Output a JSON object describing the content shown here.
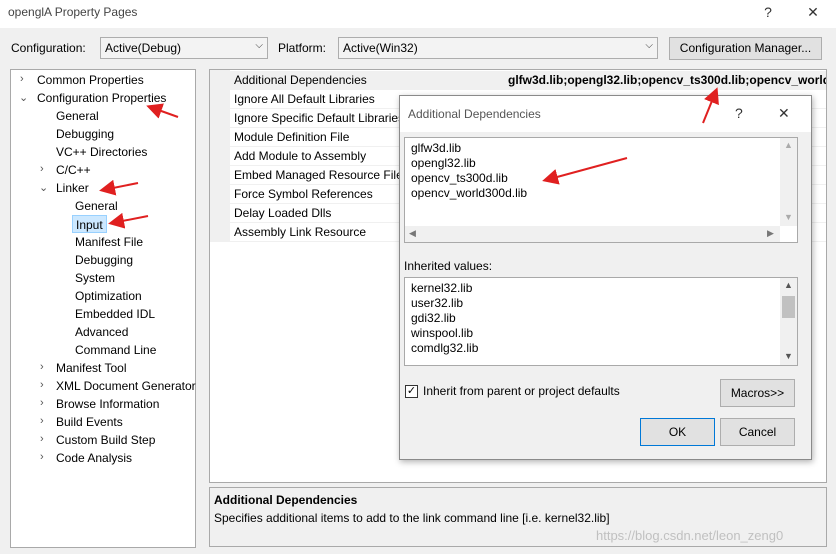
{
  "window": {
    "title": "openglA Property Pages",
    "help_btn": "?",
    "close_btn": "✕"
  },
  "config_row": {
    "configuration_label": "Configuration:",
    "configuration_value": "Active(Debug)",
    "platform_label": "Platform:",
    "platform_value": "Active(Win32)",
    "manager_button": "Configuration Manager..."
  },
  "tree": {
    "common_properties": "Common Properties",
    "configuration_properties": "Configuration Properties",
    "general": "General",
    "debugging": "Debugging",
    "vc_directories": "VC++ Directories",
    "c_cpp": "C/C++",
    "linker": "Linker",
    "linker_general": "General",
    "linker_input": "Input",
    "linker_manifest_file": "Manifest File",
    "linker_debugging": "Debugging",
    "linker_system": "System",
    "linker_optimization": "Optimization",
    "linker_embedded_idl": "Embedded IDL",
    "linker_advanced": "Advanced",
    "linker_command_line": "Command Line",
    "manifest_tool": "Manifest Tool",
    "xml_document_generator": "XML Document Generator",
    "browse_information": "Browse Information",
    "build_events": "Build Events",
    "custom_build_step": "Custom Build Step",
    "code_analysis": "Code Analysis"
  },
  "properties": [
    {
      "name": "Additional Dependencies",
      "value": "glfw3d.lib;opengl32.lib;opencv_ts300d.lib;opencv_world300d.lib"
    },
    {
      "name": "Ignore All Default Libraries"
    },
    {
      "name": "Ignore Specific Default Libraries"
    },
    {
      "name": "Module Definition File"
    },
    {
      "name": "Add Module to Assembly"
    },
    {
      "name": "Embed Managed Resource File"
    },
    {
      "name": "Force Symbol References"
    },
    {
      "name": "Delay Loaded Dlls"
    },
    {
      "name": "Assembly Link Resource"
    }
  ],
  "description": {
    "title": "Additional Dependencies",
    "text": "Specifies additional items to add to the link command line [i.e. kernel32.lib]"
  },
  "watermark": "https://blog.csdn.net/leon_zeng0",
  "dialog": {
    "title": "Additional Dependencies",
    "help_btn": "?",
    "close_btn": "✕",
    "entries": [
      "glfw3d.lib",
      "opengl32.lib",
      "opencv_ts300d.lib",
      "opencv_world300d.lib"
    ],
    "inherited_label": "Inherited values:",
    "inherited": [
      "kernel32.lib",
      "user32.lib",
      "gdi32.lib",
      "winspool.lib",
      "comdlg32.lib"
    ],
    "inherit_checkbox_label": "Inherit from parent or project defaults",
    "inherit_checked": true,
    "macros_button": "Macros>>",
    "ok_button": "OK",
    "cancel_button": "Cancel"
  },
  "colors": {
    "selection": "#cce8ff",
    "annotation_arrow": "#e02020"
  }
}
